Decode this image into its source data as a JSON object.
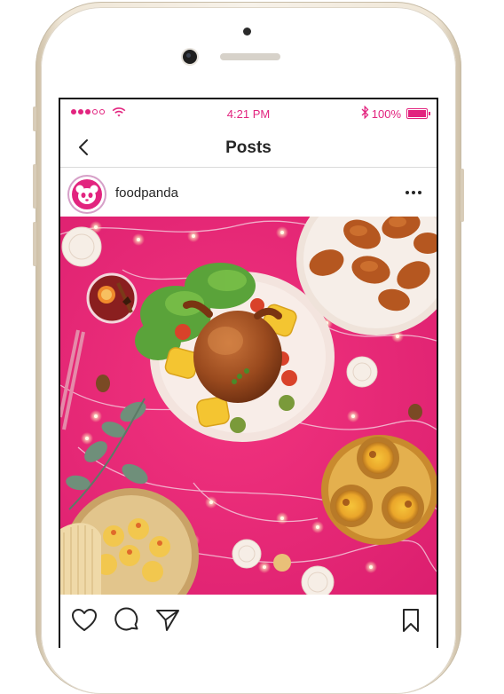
{
  "status_bar": {
    "time": "4:21 PM",
    "battery": "100%"
  },
  "nav": {
    "title": "Posts"
  },
  "post": {
    "username": "foodpanda"
  },
  "colors": {
    "accent": "#e2247f",
    "photo_background": "#ee2a7b"
  },
  "icons": {
    "back": "chevron-left-icon",
    "more": "more-horizontal-icon",
    "like": "heart-icon",
    "comment": "comment-icon",
    "share": "send-icon",
    "save": "bookmark-icon"
  }
}
